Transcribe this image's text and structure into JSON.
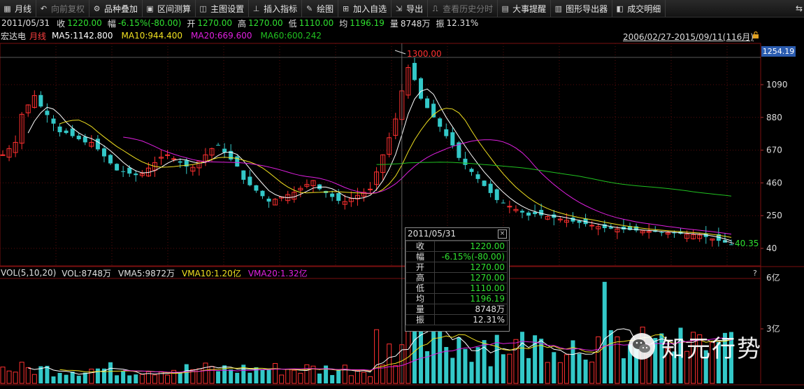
{
  "toolbar": {
    "items": [
      {
        "label": "月线",
        "icon": "calendar-icon",
        "enabled": true
      },
      {
        "label": "向前复权",
        "icon": "restore-icon",
        "enabled": false
      },
      {
        "label": "品种叠加",
        "icon": "overlay-icon",
        "enabled": true
      },
      {
        "label": "区间测算",
        "icon": "range-icon",
        "enabled": true
      },
      {
        "label": "主图设置",
        "icon": "settings-icon",
        "enabled": true
      },
      {
        "label": "插入指标",
        "icon": "indicator-icon",
        "enabled": true
      },
      {
        "label": "绘图",
        "icon": "draw-icon",
        "enabled": true
      },
      {
        "label": "加入自选",
        "icon": "add-icon",
        "enabled": true
      },
      {
        "label": "导出",
        "icon": "export-icon",
        "enabled": true
      },
      {
        "label": "查看历史分时",
        "icon": "history-icon",
        "enabled": false
      },
      {
        "label": "大事提醒",
        "icon": "event-icon",
        "enabled": true
      },
      {
        "label": "图形导出器",
        "icon": "chart-export-icon",
        "enabled": true
      },
      {
        "label": "成交明细",
        "icon": "detail-icon",
        "enabled": true
      }
    ]
  },
  "quote": {
    "date": "2011/05/31",
    "close_label": "收",
    "close": "1220.00",
    "change_label": "幅",
    "change": "-6.15%(-80.00)",
    "open_label": "开",
    "open": "1270.00",
    "high_label": "高",
    "high": "1270.00",
    "low_label": "低",
    "low": "1110.00",
    "avg_label": "均",
    "avg": "1196.19",
    "volume_label": "量",
    "volume": "8748万",
    "amplitude_label": "振",
    "amplitude": "12.31%"
  },
  "ma_line": {
    "stock_name": "宏达电",
    "period": "月线",
    "ma5": "MA5:1142.800",
    "ma10": "MA10:944.400",
    "ma20": "MA20:669.600",
    "ma60": "MA60:600.242"
  },
  "range_label": "2006/02/27-2015/09/11(116月)",
  "price_tag": "1254.19",
  "price_axis": [
    "1090",
    "880",
    "670",
    "460",
    "250",
    "40"
  ],
  "high_mark": "1300.00",
  "low_mark": "40.35",
  "vol_line": {
    "title": "VOL(5,10,20)",
    "vol": "VOL:8748万",
    "vma5": "VMA5:9872万",
    "vma10": "VMA10:1.20亿",
    "vma20": "VMA20:1.32亿"
  },
  "vol_axis": [
    "6亿",
    "3亿"
  ],
  "question_mark": "?",
  "tooltip": {
    "date": "2011/05/31",
    "rows": [
      {
        "k": "收",
        "v": "1220.00",
        "color": "#30e030"
      },
      {
        "k": "幅",
        "v": "-6.15%(-80.00)",
        "color": "#30e030"
      },
      {
        "k": "开",
        "v": "1270.00",
        "color": "#30e030"
      },
      {
        "k": "高",
        "v": "1270.00",
        "color": "#30e030"
      },
      {
        "k": "低",
        "v": "1110.00",
        "color": "#30e030"
      },
      {
        "k": "均",
        "v": "1196.19",
        "color": "#30e030"
      },
      {
        "k": "量",
        "v": "8748万",
        "color": "#e0e0e0"
      },
      {
        "k": "振",
        "v": "12.31%",
        "color": "#e0e0e0"
      }
    ]
  },
  "watermark": "知元行势",
  "colors": {
    "up": "#ff3030",
    "down": "#33c8c8",
    "ma5": "#ffffff",
    "ma10": "#f0e020",
    "ma20": "#e020e0",
    "ma60": "#20c020",
    "grid": "#7a1010"
  },
  "chart_data": {
    "type": "candlestick",
    "period": "monthly",
    "x_range": [
      "2006/02/27",
      "2015/09/11"
    ],
    "months": 116,
    "y_ticks": [
      40,
      250,
      460,
      670,
      880,
      1090
    ],
    "high_label": 1300.0,
    "low_label": 40.35,
    "crosshair_date": "2011/05/31"
  }
}
